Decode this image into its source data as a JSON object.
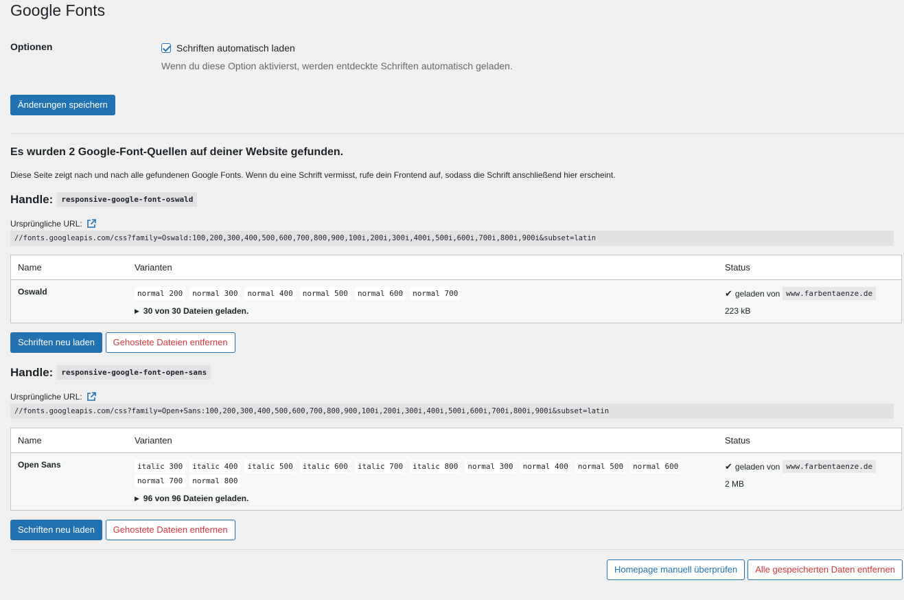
{
  "page": {
    "title": "Google Fonts"
  },
  "options": {
    "label": "Optionen",
    "autoload_label": "Schriften automatisch laden",
    "autoload_checked": true,
    "description": "Wenn du diese Option aktivierst, werden entdeckte Schriften automatisch geladen.",
    "save_label": "Änderungen speichern"
  },
  "found": {
    "heading": "Es wurden 2 Google-Font-Quellen auf deiner Website gefunden.",
    "intro": "Diese Seite zeigt nach und nach alle gefundenen Google Fonts. Wenn du eine Schrift vermisst, rufe dein Frontend auf, sodass die Schrift anschließend hier erscheint."
  },
  "labels": {
    "handle": "Handle:",
    "original_url": "Ursprüngliche URL:",
    "col_name": "Name",
    "col_variants": "Varianten",
    "col_status": "Status",
    "loaded_from": "geladen von",
    "reload": "Schriften neu laden",
    "remove_hosted": "Gehostete Dateien entfernen"
  },
  "handles": [
    {
      "handle": "responsive-google-font-oswald",
      "url": "//fonts.googleapis.com/css?family=Oswald:100,200,300,400,500,600,700,800,900,100i,200i,300i,400i,500i,600i,700i,800i,900i&subset=latin",
      "font_name": "Oswald",
      "variants": [
        "normal 200",
        "normal 300",
        "normal 400",
        "normal 500",
        "normal 600",
        "normal 700"
      ],
      "files": "30 von 30 Dateien geladen.",
      "domain": "www.farbentaenze.de",
      "size": "223 kB"
    },
    {
      "handle": "responsive-google-font-open-sans",
      "url": "//fonts.googleapis.com/css?family=Open+Sans:100,200,300,400,500,600,700,800,900,100i,200i,300i,400i,500i,600i,700i,800i,900i&subset=latin",
      "font_name": "Open Sans",
      "variants": [
        "italic 300",
        "italic 400",
        "italic 500",
        "italic 600",
        "italic 700",
        "italic 800",
        "normal 300",
        "normal 400",
        "normal 500",
        "normal 600",
        "normal 700",
        "normal 800"
      ],
      "files": "96 von 96 Dateien geladen.",
      "domain": "www.farbentaenze.de",
      "size": "2 MB"
    }
  ],
  "footer": {
    "check_homepage": "Homepage manuell überprüfen",
    "remove_all": "Alle gespeicherten Daten entfernen"
  },
  "icons": {
    "checkbox": "checkmark-icon",
    "external": "external-link-icon",
    "expand": "triangle-right-icon",
    "status": "checkmark-icon"
  },
  "colors": {
    "primary": "#2271b1",
    "danger": "#d63638",
    "background": "#f0f0f1"
  }
}
